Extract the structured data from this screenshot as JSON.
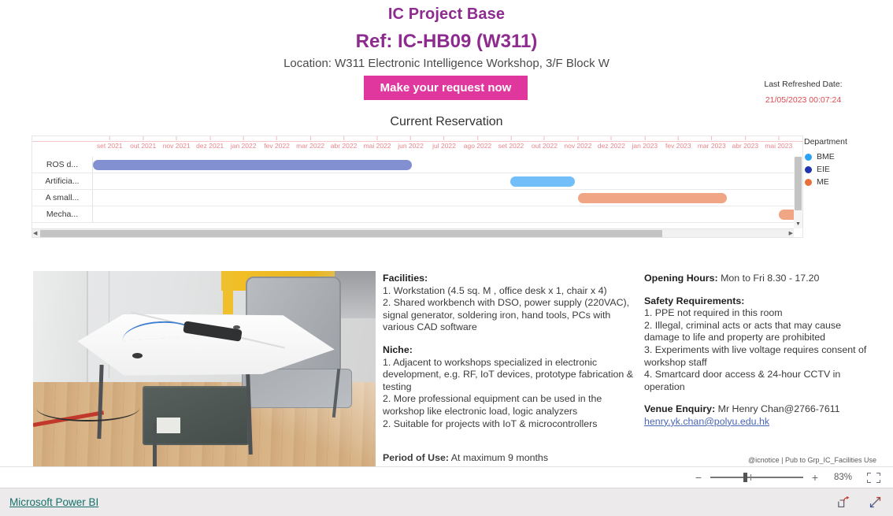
{
  "header": {
    "title": "IC Project Base",
    "ref": "Ref: IC-HB09 (W311)",
    "location": "Location: W311 Electronic Intelligence Workshop, 3/F Block W",
    "cta_label": "Make your request now",
    "refresh_label": "Last Refreshed Date:",
    "refresh_value": "21/05/2023 00:07:24",
    "accent_purple": "#8d2b8f",
    "accent_pink": "#e0379f",
    "refresh_color": "#e04a52"
  },
  "gantt": {
    "title": "Current Reservation",
    "axis_ticks": [
      "set 2021",
      "out 2021",
      "nov 2021",
      "dez 2021",
      "jan 2022",
      "fev 2022",
      "mar 2022",
      "abr 2022",
      "mai 2022",
      "jun 2022",
      "jul 2022",
      "ago 2022",
      "set 2022",
      "out 2022",
      "nov 2022",
      "dez 2022",
      "jan 2023",
      "fev 2023",
      "mar 2023",
      "abr 2023",
      "mai 2023"
    ],
    "rows": [
      {
        "label": "ROS d...",
        "start_pct": 0.0,
        "width_pct": 44.9,
        "color": "#8290d1",
        "department": "EIE"
      },
      {
        "label": "Artificia...",
        "start_pct": 58.8,
        "width_pct": 9.1,
        "color": "#71bef8",
        "department": "BME"
      },
      {
        "label": "A small...",
        "start_pct": 68.4,
        "width_pct": 21.0,
        "color": "#f0a585",
        "department": "ME"
      },
      {
        "label": "Mecha...",
        "start_pct": 96.7,
        "width_pct": 4.0,
        "color": "#f0a585",
        "department": "ME"
      }
    ],
    "legend_title": "Department",
    "legend": [
      {
        "label": "BME",
        "color": "#2ca3f2"
      },
      {
        "label": "EIE",
        "color": "#1f35b0"
      },
      {
        "label": "ME",
        "color": "#e8703a"
      }
    ]
  },
  "content": {
    "facilities_heading": "Facilities:",
    "facilities_lines": [
      "1. Workstation (4.5 sq. M , office desk x 1, chair x 4)",
      "2. Shared workbench with DSO, power supply (220VAC), signal generator, soldering iron, hand tools, PCs with various CAD software"
    ],
    "niche_heading": "Niche:",
    "niche_lines": [
      "1. Adjacent to workshops specialized in electronic development, e.g. RF, IoT devices, prototype fabrication & testing",
      "2. More professional equipment can be used in the workshop like electronic load, logic analyzers",
      "2. Suitable for projects with IoT & microcontrollers"
    ],
    "period_label": "Period of Use:",
    "period_value": "At maximum 9 months",
    "opening_label": "Opening Hours:",
    "opening_value": "Mon to Fri 8.30 - 17.20",
    "safety_heading": "Safety Requirements:",
    "safety_lines": [
      "1. PPE not required in this room",
      "2. Illegal, criminal acts or acts that may cause damage to life and property are prohibited",
      "3. Experiments with live voltage requires consent of workshop staff",
      "4. Smartcard door access & 24-hour CCTV in operation"
    ],
    "enquiry_label": "Venue Enquiry:",
    "enquiry_value": "Mr Henry Chan@2766-7611",
    "enquiry_email": "henry.yk.chan@polyu.edu.hk",
    "pub_note": "@icnotice | Pub to Grp_IC_Facilities Use"
  },
  "toolbar": {
    "zoom_minus": "−",
    "zoom_plus": "+",
    "zoom_percent": "83%",
    "fit_icon": "fit-to-page-icon"
  },
  "footer": {
    "brand": "Microsoft Power BI",
    "brand_color": "#15706b",
    "share_icon": "share-icon",
    "fullscreen_icon": "fullscreen-icon"
  }
}
